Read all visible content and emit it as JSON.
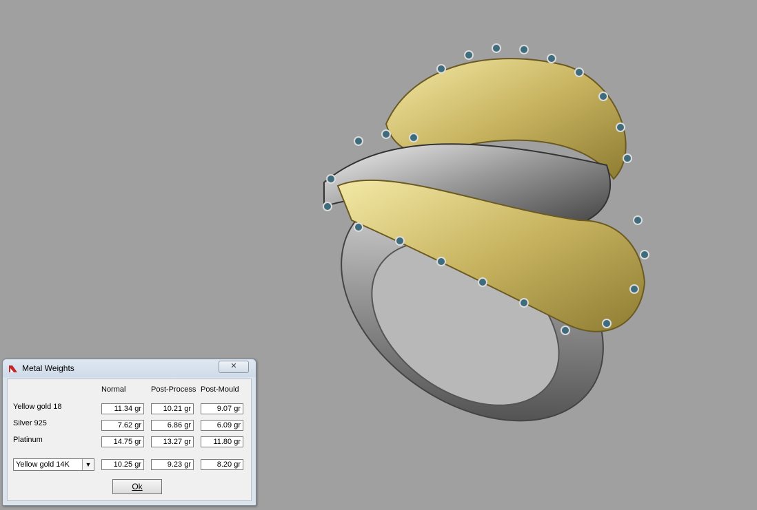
{
  "viewport": {
    "background_color": "#a0a0a0",
    "model": "ring-3d-render"
  },
  "dialog": {
    "title": "Metal Weights",
    "close_label": "✕",
    "columns": [
      "Normal",
      "Post-Process",
      "Post-Mould"
    ],
    "rows": [
      {
        "label": "Yellow gold 18",
        "values": [
          "11.34 gr",
          "10.21 gr",
          "9.07 gr"
        ]
      },
      {
        "label": "Silver 925",
        "values": [
          "7.62 gr",
          "6.86 gr",
          "6.09 gr"
        ]
      },
      {
        "label": "Platinum",
        "values": [
          "14.75 gr",
          "13.27 gr",
          "11.80 gr"
        ]
      }
    ],
    "custom_row": {
      "selected": "Yellow gold 14K",
      "values": [
        "10.25 gr",
        "9.23 gr",
        "8.20 gr"
      ]
    },
    "ok_label": "Ok"
  }
}
